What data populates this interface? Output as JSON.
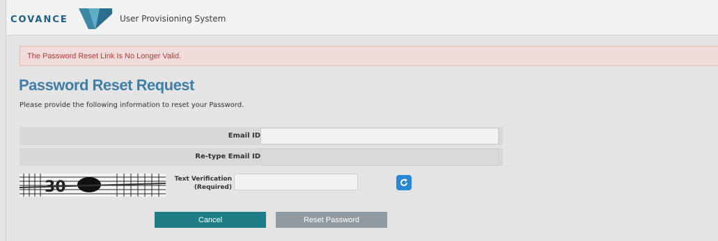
{
  "header": {
    "logo_text": "COVANCE",
    "app_title": "User Provisioning System"
  },
  "alert": {
    "message": "The Password Reset Link Is No Longer Valid."
  },
  "page": {
    "title": "Password Reset Request",
    "instructions": "Please provide the following information to reset your Password."
  },
  "form": {
    "email_label": "Email ID",
    "email_value": "",
    "retype_email_label": "Re-type Email ID",
    "retype_email_value": "",
    "captcha_text": "30",
    "text_verification_label_line1": "Text Verification",
    "text_verification_label_line2": "(Required)",
    "text_verification_value": "",
    "refresh_icon": "refresh-icon"
  },
  "buttons": {
    "cancel_label": "Cancel",
    "reset_label": "Reset Password"
  },
  "colors": {
    "brand_blue": "#1f5d86",
    "heading_blue": "#3f7ea7",
    "cancel_teal": "#1e7d86",
    "reset_gray": "#8f9aa2",
    "alert_text": "#b23a3a",
    "refresh_blue": "#2a86d6"
  }
}
